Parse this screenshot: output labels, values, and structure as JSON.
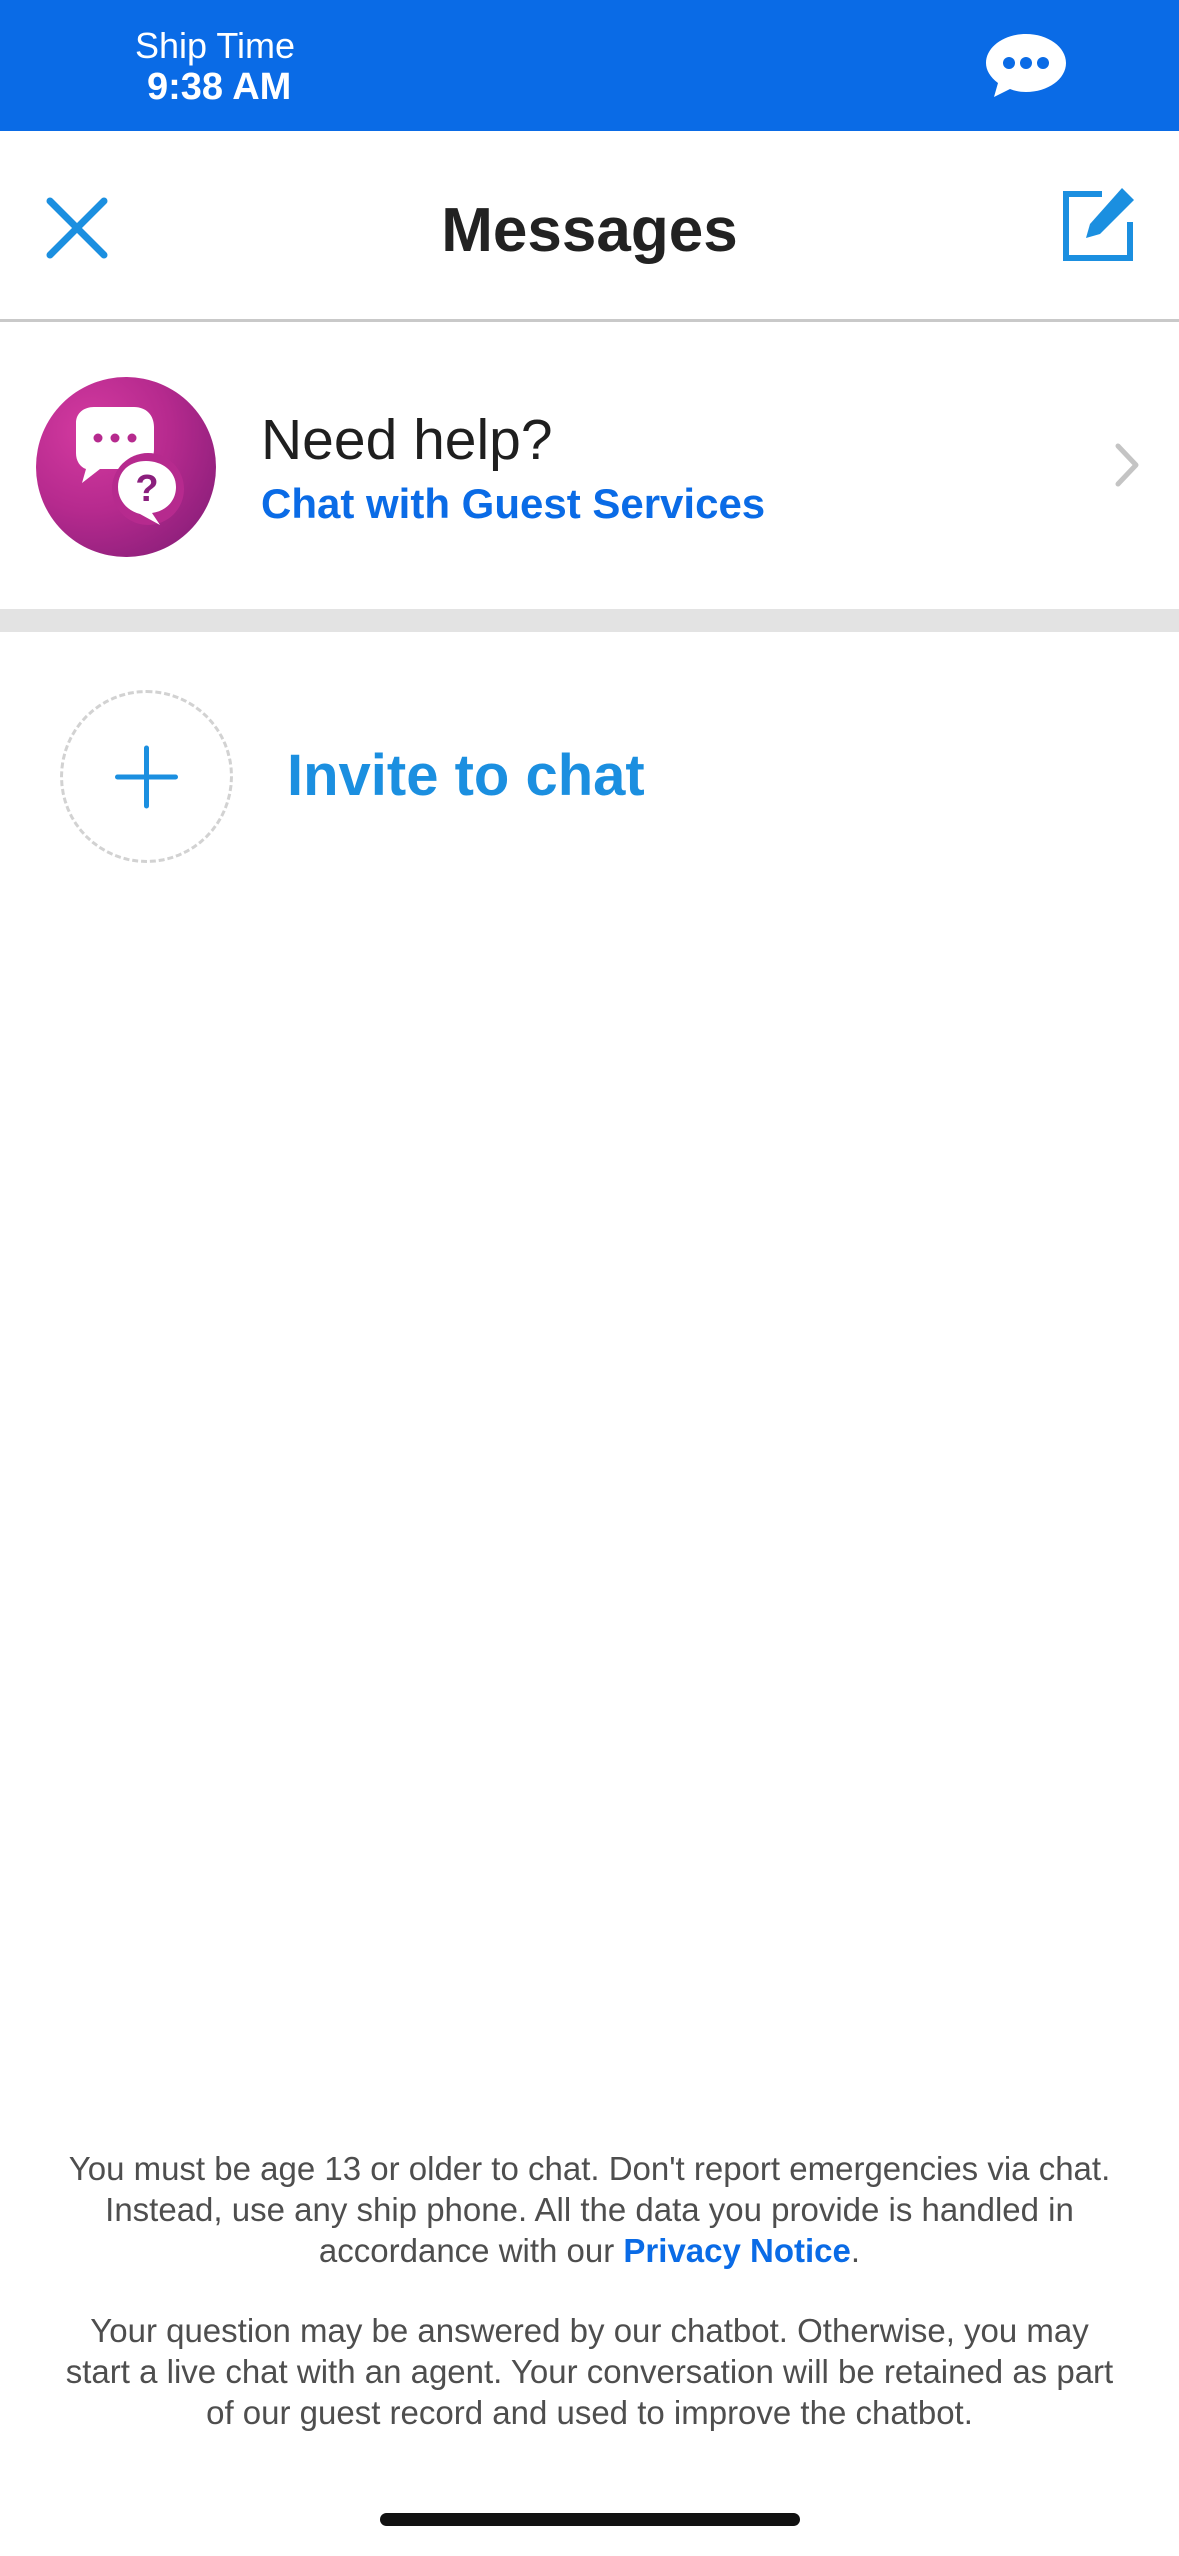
{
  "status_bar": {
    "ship_time_label": "Ship Time",
    "ship_time_value": "9:38 AM",
    "chat_icon": "chat-bubble-icon",
    "color": "#0a6be6"
  },
  "header": {
    "title": "Messages",
    "close_icon": "close-icon",
    "compose_icon": "compose-icon"
  },
  "help": {
    "title": "Need help?",
    "link": "Chat with Guest Services",
    "avatar_icon": "help-chat-icon",
    "chevron_icon": "chevron-right-icon"
  },
  "invite": {
    "label": "Invite to chat",
    "icon": "plus-icon"
  },
  "footer": {
    "disclaimer_1_before": "You must be age 13 or older to chat. Don't report emergencies via chat. Instead, use any ship phone. All the data you provide is handled in accordance with our ",
    "privacy_link": "Privacy Notice",
    "disclaimer_1_after": ".",
    "disclaimer_2": "Your question may be answered by our chatbot. Otherwise, you may start a live chat with an agent. Your conversation will be retained as part of our guest record and used to improve the chatbot."
  },
  "colors": {
    "accent": "#0a6be6",
    "invite_blue": "#1b8fe0",
    "help_magenta": "#b62a8e"
  }
}
